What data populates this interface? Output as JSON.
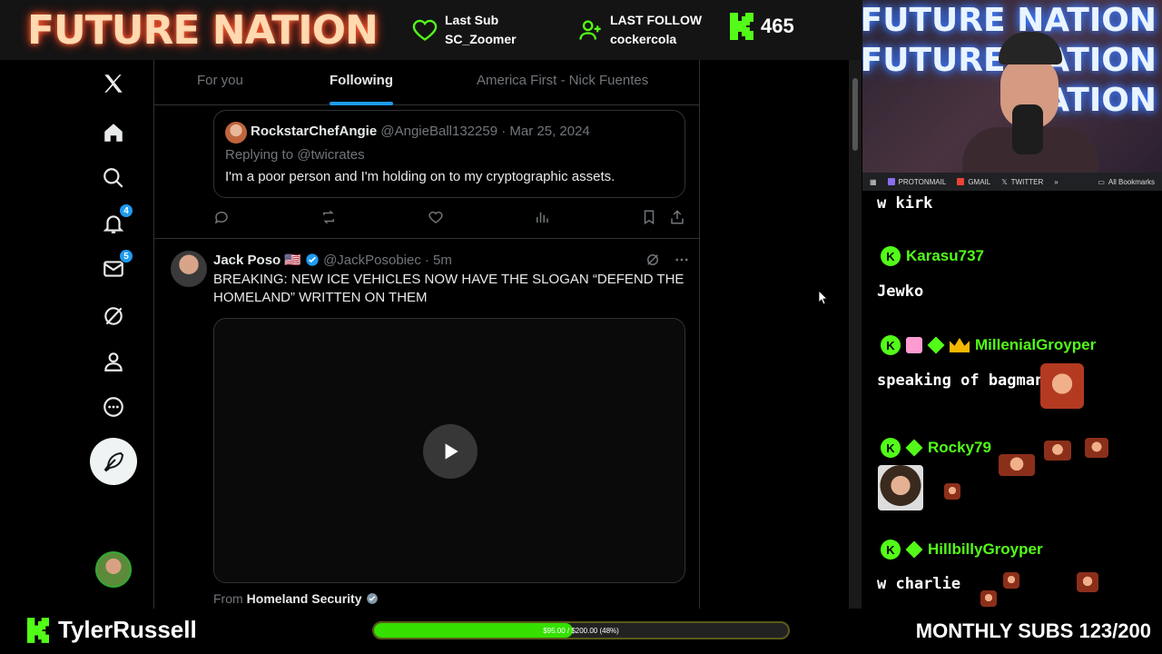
{
  "overlay": {
    "brand": "FUTURE NATION",
    "last_sub_label": "Last Sub",
    "last_sub_value": "SC_Zoomer",
    "last_follow_label": "LAST FOLLOW",
    "last_follow_value": "cockercola",
    "viewer_count": "465",
    "accent_color": "#53fc18"
  },
  "twitter": {
    "nav": {
      "notifications_badge": "4",
      "messages_badge": "5"
    },
    "tabs": [
      {
        "label": "For you"
      },
      {
        "label": "Following"
      },
      {
        "label": "America First - Nick Fuentes"
      }
    ],
    "active_tab": "Following",
    "quoted": {
      "name": "RockstarChefAngie",
      "handle": "@AngieBall132259",
      "date": "· Mar 25, 2024",
      "replying": "Replying to @twicrates",
      "text": "I'm a poor person and I'm holding on to my cryptographic assets."
    },
    "tweet": {
      "name": "Jack Poso 🇺🇸",
      "handle": "@JackPosobiec",
      "time": "· 5m",
      "text": "BREAKING: NEW ICE VEHICLES NOW HAVE THE SLOGAN “DEFEND THE HOMELAND” WRITTEN ON THEM",
      "from_label": "From",
      "from_source": "Homeland Security"
    }
  },
  "bookmarks": {
    "items": [
      "PROTONMAIL",
      "GMAIL",
      "TWITTER"
    ],
    "more": "»",
    "all": "All Bookmarks"
  },
  "webcam": {
    "neon_lines": [
      "FUTURE NATION",
      "FUTURE NATION",
      "NATION"
    ]
  },
  "chat": {
    "messages": [
      {
        "user": "",
        "text": "w kirk"
      },
      {
        "user": "Karasu737",
        "text": "Jewko"
      },
      {
        "user": "MillenialGroyper",
        "text": "speaking of bagman"
      },
      {
        "user": "Rocky79",
        "text": ""
      },
      {
        "user": "HillbillyGroyper",
        "text": "w charlie"
      }
    ]
  },
  "footer": {
    "streamer": "TylerRussell",
    "goal_text": "$95.00 / $200.00 (48%)",
    "goal_fraction": 0.48,
    "monthly_subs": "MONTHLY SUBS 123/200"
  }
}
